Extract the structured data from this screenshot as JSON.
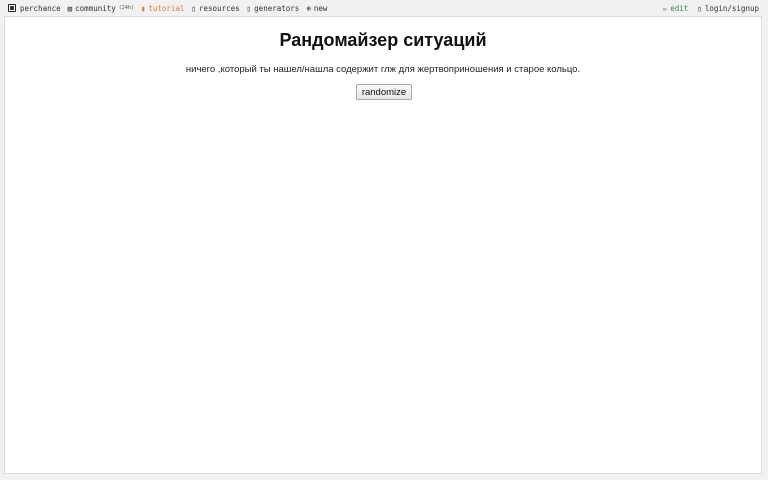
{
  "nav": {
    "left": [
      {
        "label": "perchance",
        "icon": "dice-icon"
      },
      {
        "label": "community",
        "icon": "chat-icon",
        "count": "(24h)"
      },
      {
        "label": "tutorial",
        "icon": "book-icon"
      },
      {
        "label": "resources",
        "icon": "resources-icon"
      },
      {
        "label": "generators",
        "icon": "generators-icon"
      },
      {
        "label": "new",
        "icon": "plus-circle-icon"
      }
    ],
    "right": [
      {
        "label": "edit",
        "icon": "pencil-icon"
      },
      {
        "label": "login/signup",
        "icon": "user-icon"
      }
    ]
  },
  "colors": {
    "tutorial": "#d9822b",
    "edit": "#2f8a3a"
  },
  "main": {
    "title": "Рандомайзер ситуаций",
    "output": "ничего ,который ты нашел/нашла содержит глж для жертвоприношения и старое кольцо.",
    "button_label": "randomize"
  }
}
